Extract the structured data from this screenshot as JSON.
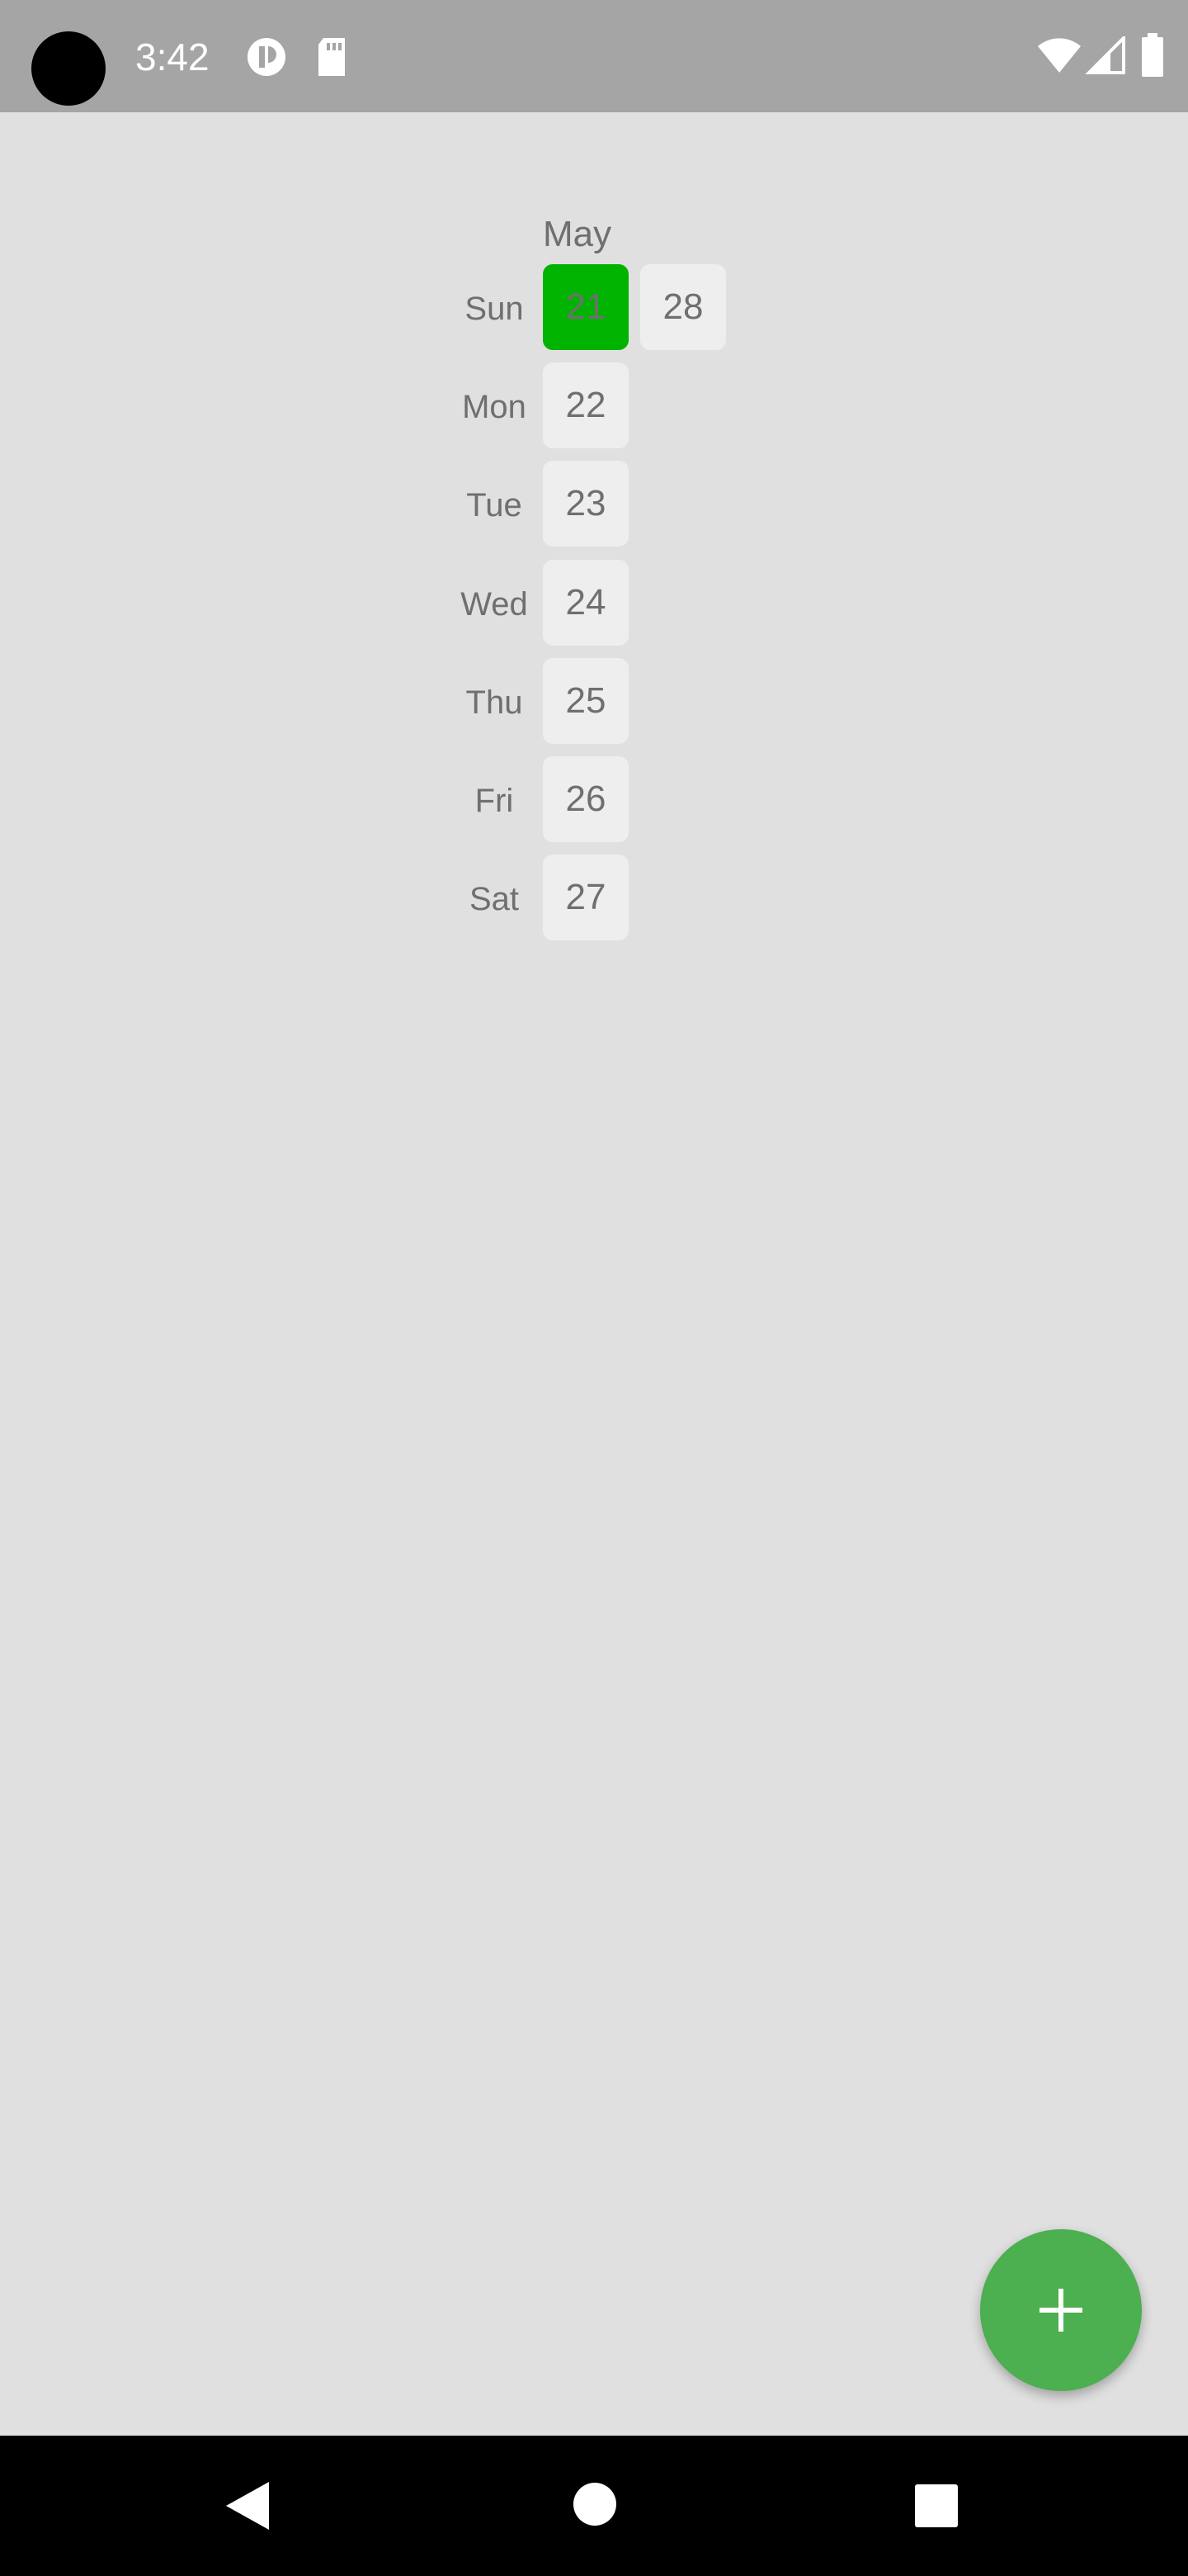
{
  "status_bar": {
    "time": "3:42",
    "icons": [
      "camera-cutout-icon",
      "notification-app-icon",
      "sd-card-icon",
      "wifi-icon",
      "cell-signal-icon",
      "battery-icon"
    ]
  },
  "calendar": {
    "month": "May",
    "days": [
      {
        "label": "Sun",
        "dates": [
          "21",
          "28"
        ]
      },
      {
        "label": "Mon",
        "dates": [
          "22"
        ]
      },
      {
        "label": "Tue",
        "dates": [
          "23"
        ]
      },
      {
        "label": "Wed",
        "dates": [
          "24"
        ]
      },
      {
        "label": "Thu",
        "dates": [
          "25"
        ]
      },
      {
        "label": "Fri",
        "dates": [
          "26"
        ]
      },
      {
        "label": "Sat",
        "dates": [
          "27"
        ]
      }
    ],
    "selected_date": "21",
    "selected_color": "#00b300"
  },
  "fab": {
    "icon": "plus-icon",
    "color": "#4caf50"
  },
  "nav_bar": {
    "icons": [
      "back-icon",
      "home-icon",
      "recents-icon"
    ]
  }
}
